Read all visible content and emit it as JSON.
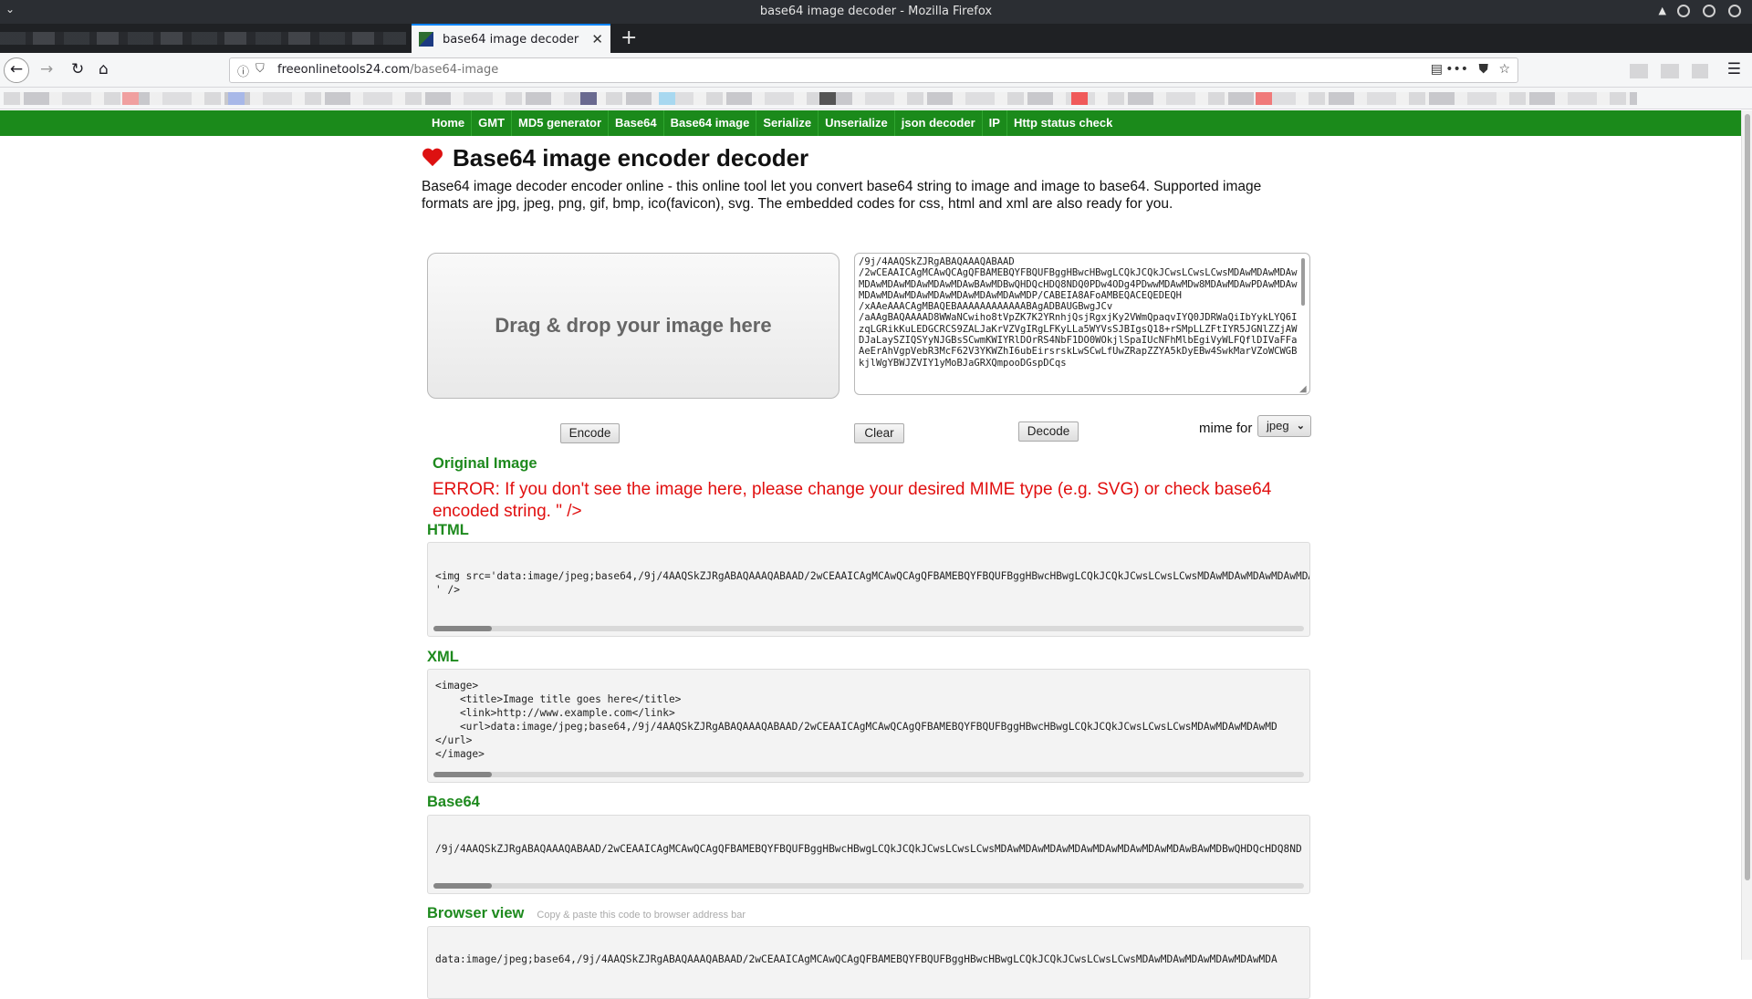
{
  "window": {
    "title": "base64 image decoder - Mozilla Firefox"
  },
  "browser": {
    "tab_title": "base64 image decoder",
    "url_domain": "freeonlinetools24.com",
    "url_path": "/base64-image"
  },
  "nav": {
    "items": [
      "Home",
      "GMT",
      "MD5 generator",
      "Base64",
      "Base64 image",
      "Serialize",
      "Unserialize",
      "json decoder",
      "IP",
      "Http status check"
    ]
  },
  "page": {
    "heading": "Base64 image encoder decoder",
    "intro": "Base64 image decoder encoder online - this online tool let you convert base64 string to image and image to base64. Supported image formats are jpg, jpeg, png, gif, bmp, ico(favicon), svg. The embedded codes for css, html and xml are also ready for you.",
    "dropzone_label": "Drag & drop your image here",
    "base64_text": "/9j/4AAQSkZJRgABAQAAAQABAAD\n/2wCEAAICAgMCAwQCAgQFBAMEBQYFBQUFBggHBwcHBwgLCQkJCQkJCwsLCwsLCwsMDAwMDAwMDAwMDAwMDAwMDAwMDAwMDAwBAwMDBwQHDQcHDQ8NDQ0PDw4ODg4PDwwMDAwMDw8MDAwMDAwPDAwMDAwMDAwMDAwMDAwMDAwMDAwMDAwMDAwMDP/CABEIA8AFoAMBEQACEQEDEQH\n/xAAeAAACAgMBAQEBAAAAAAAAAAAABAgADBAUGBwgJCv\n/aAAgBAQAAAAD8WWaNCwiho8tVpZK7K2YRnhjQsjRgxjKy2VWmQpaqvIYQ0JDRWaQiIbYykLYQ6IzqLGRikKuLEDGCRCS9ZALJaKrVZVgIRgLFKyLLa5WYVsSJBIgsQ18+rSMpLLZFtIYR5JGNlZZjAWDJaLaySZIQSYyNJGBsSCwmKWIYRlDOrRS4NbF1DO0WOkjlSpaIUcNFhMlbEgiVyWLFQflDIVaFFaAeErAhVgpVebR3McF62V3YKWZhI6ubEirsrskLwSCwLfUwZRapZZYA5kDyEBw4SwkMarVZoWCWGBkjlWgYBWJZVIY1yMoBJaGRXQmpooDGspDCqs"
  },
  "buttons": {
    "encode": "Encode",
    "clear": "Clear",
    "decode": "Decode",
    "mime_label": "mime for",
    "mime_value": "jpeg"
  },
  "original": {
    "heading": "Original Image",
    "error": "ERROR: If you don't see the image here, please change your desired MIME type (e.g. SVG) or check base64 encoded string. \" />"
  },
  "html_section": {
    "heading": "HTML",
    "code": "<img src='data:image/jpeg;base64,/9j/4AAQSkZJRgABAQAAAQABAAD/2wCEAAICAgMCAwQCAgQFBAMEBQYFBQUFBggHBwcHBwgLCQkJCQkJCwsLCwsLCwsMDAwMDAwMDAwMDAwMDAwM\n' />"
  },
  "xml_section": {
    "heading": "XML",
    "code": "<image>\n    <title>Image title goes here</title>\n    <link>http://www.example.com</link>\n    <url>data:image/jpeg;base64,/9j/4AAQSkZJRgABAQAAAQABAAD/2wCEAAICAgMCAwQCAgQFBAMEBQYFBQUFBggHBwcHBwgLCQkJCQkJCwsLCwsLCwsMDAwMDAwMDAwMD\n</url>\n</image>"
  },
  "base64_section": {
    "heading": "Base64",
    "code": "/9j/4AAQSkZJRgABAQAAAQABAAD/2wCEAAICAgMCAwQCAgQFBAMEBQYFBQUFBggHBwcHBwgLCQkJCQkJCwsLCwsLCwsMDAwMDAwMDAwMDAwMDAwMDAwMDAwMDAwBAwMDBwQHDQcHDQ8ND"
  },
  "browser_view_section": {
    "heading": "Browser view",
    "hint": "Copy & paste this code to browser address bar",
    "code": "data:image/jpeg;base64,/9j/4AAQSkZJRgABAQAAAQABAAD/2wCEAAICAgMCAwQCAgQFBAMEBQYFBQUFBggHBwcHBwgLCQkJCQkJCwsLCwsLCwsMDAwMDAwMDAwMDAwMDAwMDA"
  },
  "colors": {
    "nav_green": "#1b8a1b",
    "section_green": "#1e8a1e",
    "error_red": "#e10f0f",
    "tab_accent": "#0a84ff"
  }
}
